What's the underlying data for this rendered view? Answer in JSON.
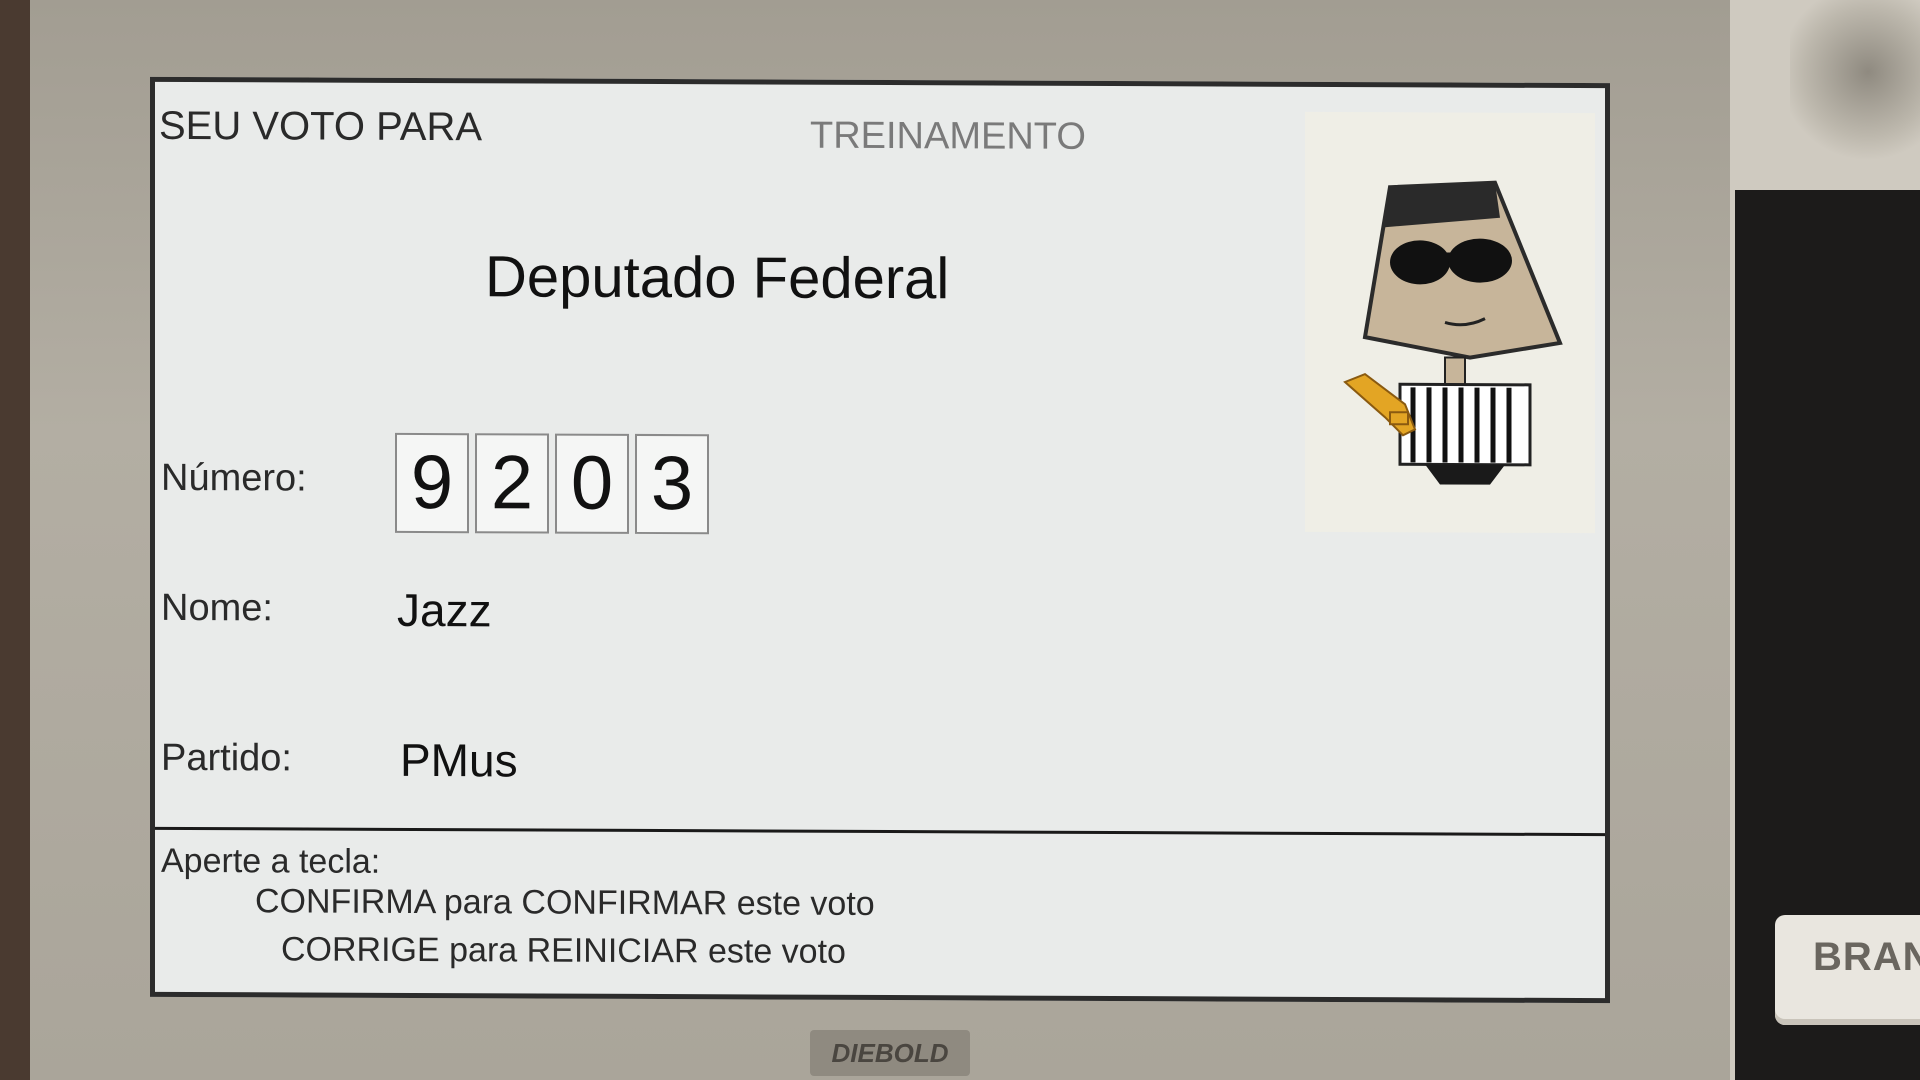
{
  "screen": {
    "header_left": "SEU VOTO PARA",
    "header_center": "TREINAMENTO",
    "office": "Deputado Federal",
    "numero_label": "Número:",
    "digits": [
      "9",
      "2",
      "0",
      "3"
    ],
    "nome_label": "Nome:",
    "nome_value": "Jazz",
    "partido_label": "Partido:",
    "partido_value": "PMus",
    "instructions": {
      "line1": "Aperte a tecla:",
      "line2": "CONFIRMA para CONFIRMAR este voto",
      "line3": "CORRIGE para REINICIAR este voto"
    }
  },
  "machine": {
    "brand": "DIEBOLD",
    "branco_key_label": "BRANC"
  },
  "icons": {
    "candidate_photo": "jazz-musician-cartoon-icon"
  },
  "colors": {
    "screen_bg": "#e9ebea",
    "bezel": "#aaa59a"
  }
}
